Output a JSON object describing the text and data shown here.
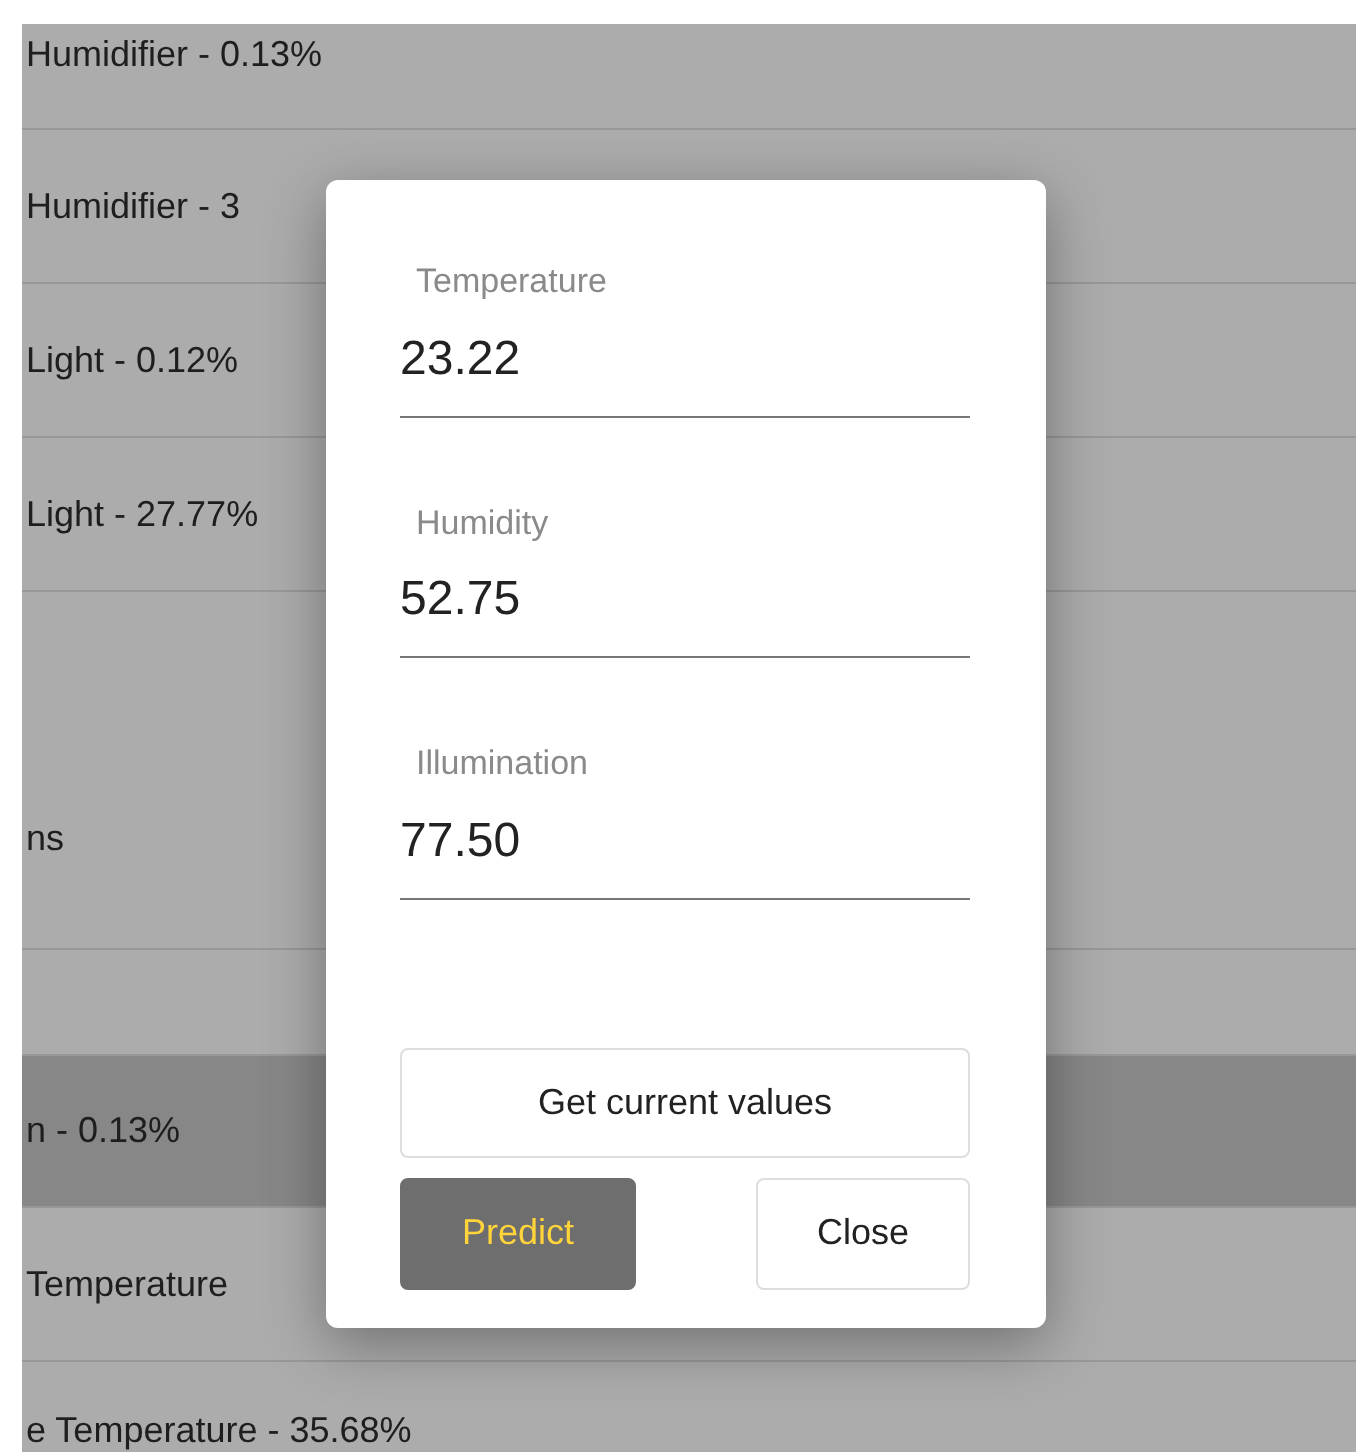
{
  "background_list": {
    "rows": [
      {
        "text": "Humidifier - 0.13%",
        "selected": false
      },
      {
        "text": "Humidifier - 3",
        "selected": false
      },
      {
        "text": "Light - 0.12%",
        "selected": false
      },
      {
        "text": "Light - 27.77%",
        "selected": false
      },
      {
        "text": "ns",
        "selected": false
      },
      {
        "selected": false
      },
      {
        "text": "n - 0.13%",
        "selected": true
      },
      {
        "text": "Temperature",
        "selected": false
      },
      {
        "text": "e Temperature - 35.68%",
        "selected": false
      }
    ]
  },
  "dialog": {
    "fields": [
      {
        "label": "Temperature",
        "value": "23.22"
      },
      {
        "label": "Humidity",
        "value": "52.75"
      },
      {
        "label": "Illumination",
        "value": "77.50"
      }
    ],
    "buttons": [
      {
        "kind": "secondary",
        "label": "Get current values"
      },
      {
        "kind": "primary",
        "label": "Predict"
      },
      {
        "kind": "secondary",
        "label": "Close"
      }
    ]
  }
}
